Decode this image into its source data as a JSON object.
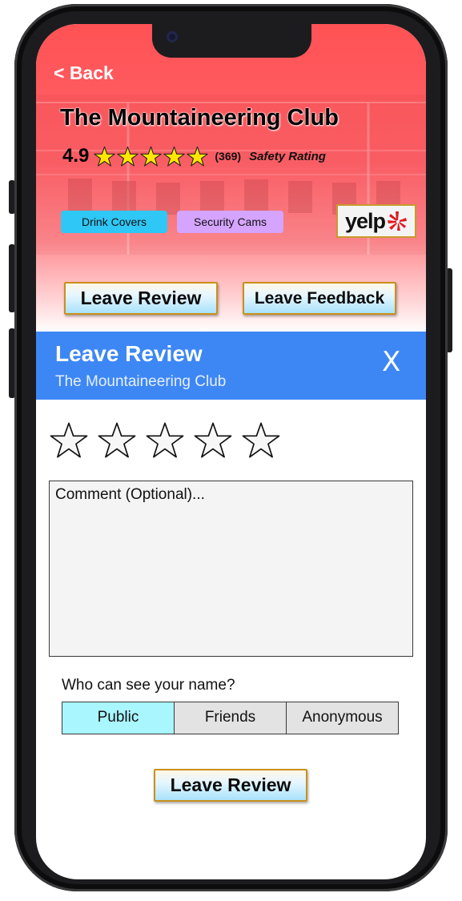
{
  "nav": {
    "back_label": "< Back"
  },
  "venue": {
    "name": "The Mountaineering Club",
    "rating": "4.9",
    "rating_value": 4.9,
    "rating_max": 5,
    "review_count": "(369)",
    "safety_label": "Safety Rating",
    "tags": [
      "Drink Covers",
      "Security Cams"
    ],
    "yelp_label": "yelp"
  },
  "actions": {
    "leave_review": "Leave Review",
    "leave_feedback": "Leave Feedback"
  },
  "modal": {
    "title": "Leave Review",
    "subtitle": "The Mountaineering Club",
    "close_label": "X",
    "star_count": 5,
    "selected_stars": 0,
    "comment_placeholder": "Comment (Optional)...",
    "comment_value": "",
    "visibility_label": "Who can see your name?",
    "visibility_options": [
      "Public",
      "Friends",
      "Anonymous"
    ],
    "visibility_selected": "Public",
    "submit_label": "Leave Review"
  },
  "colors": {
    "header_red": "#ff5255",
    "modal_blue": "#3d87f5",
    "tag_blue": "#2fc7f5",
    "tag_purple": "#d5a4ff",
    "star_yellow": "#ffe600",
    "button_border_gold": "#c9901c",
    "segment_active": "#a9f6ff",
    "yelp_red": "#e01a22"
  },
  "icons": {
    "rating_star": "filled-star-icon",
    "review_star": "outline-star-icon",
    "yelp_burst": "yelp-burst-icon"
  }
}
